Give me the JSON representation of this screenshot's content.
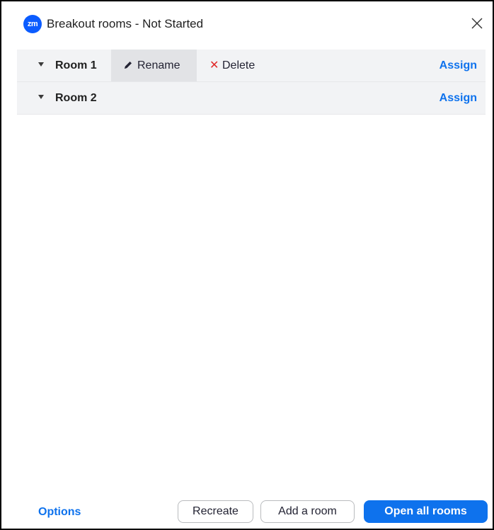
{
  "window": {
    "title": "Breakout rooms - Not Started",
    "logo_text": "zm",
    "close_icon": "close-icon"
  },
  "rooms": [
    {
      "name": "Room 1",
      "rename_label": "Rename",
      "delete_label": "Delete",
      "assign_label": "Assign"
    },
    {
      "name": "Room 2",
      "assign_label": "Assign"
    }
  ],
  "footer": {
    "options_label": "Options",
    "recreate_label": "Recreate",
    "add_room_label": "Add a room",
    "open_all_label": "Open all rooms"
  },
  "colors": {
    "accent": "#0e72ed",
    "logo": "#0b5cff",
    "delete": "#e02828",
    "row_background": "#f2f3f5",
    "hover_background": "#e2e3e6"
  }
}
